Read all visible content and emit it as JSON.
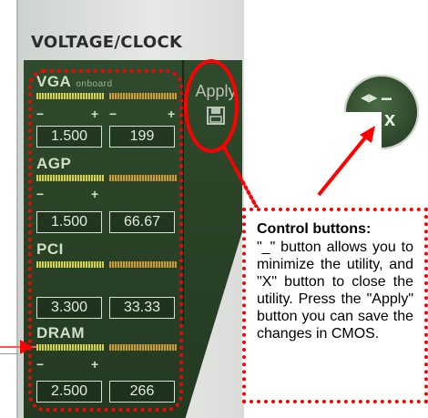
{
  "app": {
    "title": "VOLTAGE/CLOCK",
    "apply_label": "Apply",
    "sections": [
      {
        "label": "VGA",
        "sub": "onboard",
        "voltage": "1.500",
        "clock": "199"
      },
      {
        "label": "AGP",
        "voltage": "1.500",
        "clock": "66.67"
      },
      {
        "label": "PCI",
        "voltage": "3.300",
        "clock": "33.33"
      },
      {
        "label": "DRAM",
        "voltage": "2.500",
        "clock": "266"
      }
    ],
    "minus_symbol": "−",
    "plus_symbol": "+",
    "control": {
      "arrows": "◀▶",
      "minimize": "−",
      "close": "x"
    }
  },
  "callout": {
    "heading": "Control buttons:",
    "body": "\"_\" button allows you to minimize the utility, and \"X\" button to close the utility. Press the \"Apply\" button you can save the changes in CMOS."
  },
  "icons": {
    "save": "floppy-disk-icon"
  },
  "colors": {
    "panel_green": "#2f4a2c",
    "callout_red": "#ff0000"
  }
}
